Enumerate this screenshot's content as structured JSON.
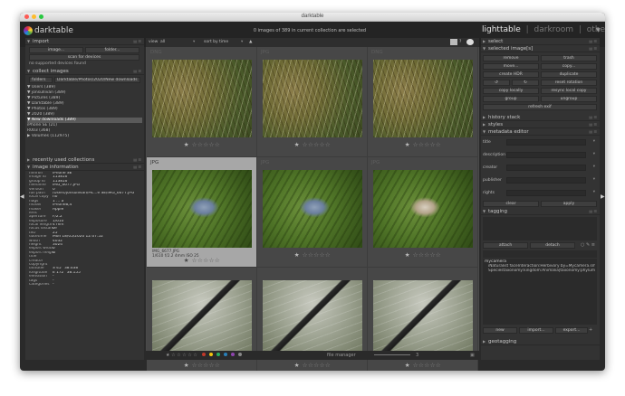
{
  "window": {
    "title": "darktable"
  },
  "header": {
    "app_name": "darktable",
    "status": "0 images of 389 in current collection are selected",
    "views": {
      "lighttable": "lighttable",
      "sep1": "|",
      "darkroom": "darkroom",
      "sep2": "|",
      "other": "other"
    },
    "menu_icon": "chevron-down-icon"
  },
  "left": {
    "import": {
      "title": "import",
      "image_btn": "image...",
      "folder_btn": "folder...",
      "scan_btn": "scan for devices",
      "no_devices": "no supported devices found"
    },
    "collect": {
      "title": "collect images",
      "mode": "folders",
      "path": "Darktable/Photos/2020/New downloads",
      "tree": [
        "▼ Users (389)",
        "▼  jonsullivan (389)",
        "▼   Pictures (389)",
        "▼    Darktable (389)",
        "▼     Photos (389)",
        "▼      2020 (389)",
        "▼       New downloads (389)",
        "              iPhone SE (21)",
        "              R003 (368)",
        "▶ Volumes (112975)"
      ],
      "selected_index": 6
    },
    "recent": {
      "title": "recently used collections"
    },
    "info": {
      "title": "image information",
      "rows": [
        [
          "filmroll",
          "iPhone SE"
        ],
        [
          "image id",
          "113816"
        ],
        [
          "group id",
          "113816"
        ],
        [
          "filename",
          "IMG_6677.JPG"
        ],
        [
          "version",
          "0"
        ],
        [
          "full path",
          "/Users/jonsullivan/Pic...e SE/IMG_6677.JPG"
        ],
        [
          "local copy",
          "no"
        ],
        [
          "flags",
          "1 ... a"
        ],
        [
          "model",
          "iPhone8,4"
        ],
        [
          "maker",
          "Apple"
        ],
        [
          "lens",
          ""
        ],
        [
          "aperture",
          "F/2.2"
        ],
        [
          "exposure",
          "1/610"
        ],
        [
          "focal length",
          "4 mm"
        ],
        [
          "focus distance",
          "0"
        ],
        [
          "ISO",
          "25"
        ],
        [
          "datetime",
          "Mon 18/05/2020 12:07:52"
        ],
        [
          "width",
          "4032"
        ],
        [
          "height",
          "3024"
        ],
        [
          "export width",
          "0"
        ],
        [
          "export height",
          "0"
        ],
        [
          "title",
          ""
        ],
        [
          "creator",
          ""
        ],
        [
          "copyright",
          ""
        ],
        [
          "latitude",
          "S 45° 38.638'"
        ],
        [
          "longitude",
          "E 172° 38.155'"
        ],
        [
          "elevation",
          "-"
        ],
        [
          "tags",
          "-"
        ],
        [
          "categories",
          "-"
        ]
      ]
    }
  },
  "center": {
    "view_label": "view",
    "view_value": "all",
    "sort_label": "sort by",
    "sort_value": "time",
    "sort_dir": "▲",
    "cells": [
      {
        "ext": "DNG",
        "photo": "grass",
        "rating": 0,
        "selected": false
      },
      {
        "ext": "JPG",
        "photo": "grass",
        "rating": 0,
        "selected": false
      },
      {
        "ext": "DNG",
        "photo": "grass",
        "rating": 0,
        "selected": false
      },
      {
        "ext": "JPG",
        "photo": "butterfly",
        "rating": 0,
        "selected": true,
        "caption1": "IMG_6677.JPG",
        "caption2": "1/610 f/2.2 4mm ISO 25"
      },
      {
        "ext": "JPG",
        "photo": "butterfly",
        "rating": 0,
        "selected": false
      },
      {
        "ext": "JPG",
        "photo": "butterfly2",
        "rating": 0,
        "selected": false
      },
      {
        "ext": "",
        "photo": "cater",
        "rating": 0,
        "selected": false
      },
      {
        "ext": "",
        "photo": "cater",
        "rating": 0,
        "selected": false
      },
      {
        "ext": "",
        "photo": "cater",
        "rating": 0,
        "selected": false
      }
    ],
    "bottom": {
      "stars": "★ ☆ ☆ ☆ ☆ ☆",
      "layout": "file manager",
      "zoom": "3",
      "color_labels": [
        "#c0392b",
        "#f1c40f",
        "#27ae60",
        "#2980b9",
        "#8e44ad",
        "#888888"
      ]
    }
  },
  "right": {
    "select": {
      "title": "select"
    },
    "selected": {
      "title": "selected image[s]",
      "buttons": [
        "remove",
        "trash",
        "move...",
        "copy...",
        "create HDR",
        "duplicate",
        "↺",
        "↻",
        "reset rotation",
        "copy locally",
        "resync local copy",
        "group",
        "ungroup"
      ],
      "refresh": "refresh exif"
    },
    "history": {
      "title": "history stack"
    },
    "styles": {
      "title": "styles"
    },
    "metadata": {
      "title": "metadata editor",
      "fields": [
        "title",
        "description",
        "creator",
        "publisher",
        "rights"
      ],
      "clear": "clear",
      "apply": "apply"
    },
    "tagging": {
      "title": "tagging",
      "attach": "attach",
      "detach": "detach",
      "dict_header": "mycamera",
      "dict_lines": [
        "iNaturalist faceInteraction:Herbivory by=Mycamera.sm",
        "Speciestaxonomy:kingdom:Animalia|taxonomy:phylum"
      ],
      "new": "new",
      "import": "import...",
      "export": "export..."
    },
    "geotag": {
      "title": "geotagging"
    }
  }
}
